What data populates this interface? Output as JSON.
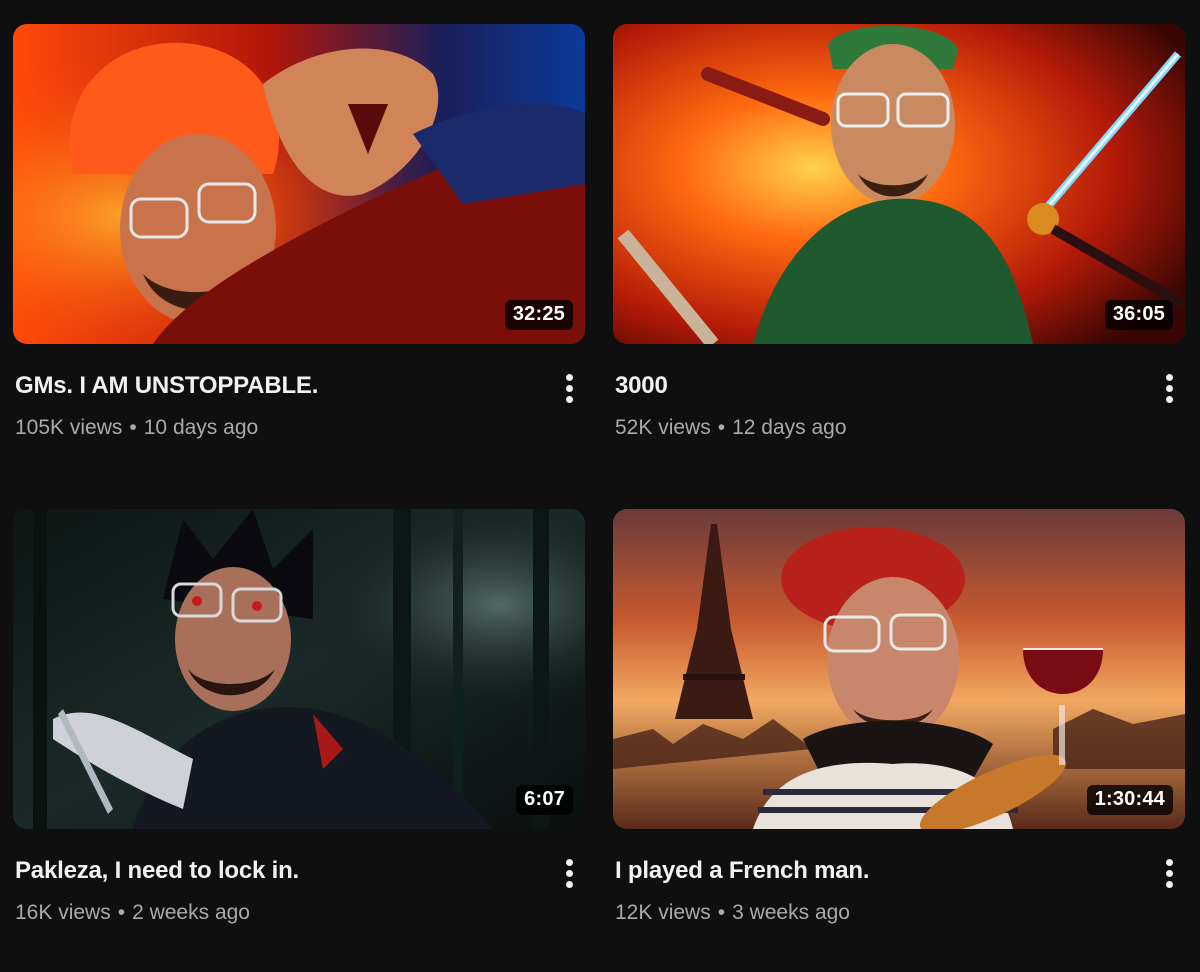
{
  "videos": [
    {
      "title": "GMs. I AM UNSTOPPABLE.",
      "views": "105K views",
      "age": "10 days ago",
      "duration": "32:25",
      "theme": "fire-and-blue-magic"
    },
    {
      "title": "3000",
      "views": "52K views",
      "age": "12 days ago",
      "duration": "36:05",
      "theme": "swordsman-explosion"
    },
    {
      "title": "Pakleza, I need to lock in.",
      "views": "16K views",
      "age": "2 weeks ago",
      "duration": "6:07",
      "theme": "dark-forest-ninja"
    },
    {
      "title": "I played a French man.",
      "views": "12K views",
      "age": "3 weeks ago",
      "duration": "1:30:44",
      "theme": "paris-sunset"
    }
  ],
  "separator": "•",
  "icons": {
    "more": "vertical-ellipsis-icon"
  },
  "colors": {
    "background": "#0f0f0f",
    "title": "#f1f1f1",
    "meta": "#aaaaaa"
  }
}
